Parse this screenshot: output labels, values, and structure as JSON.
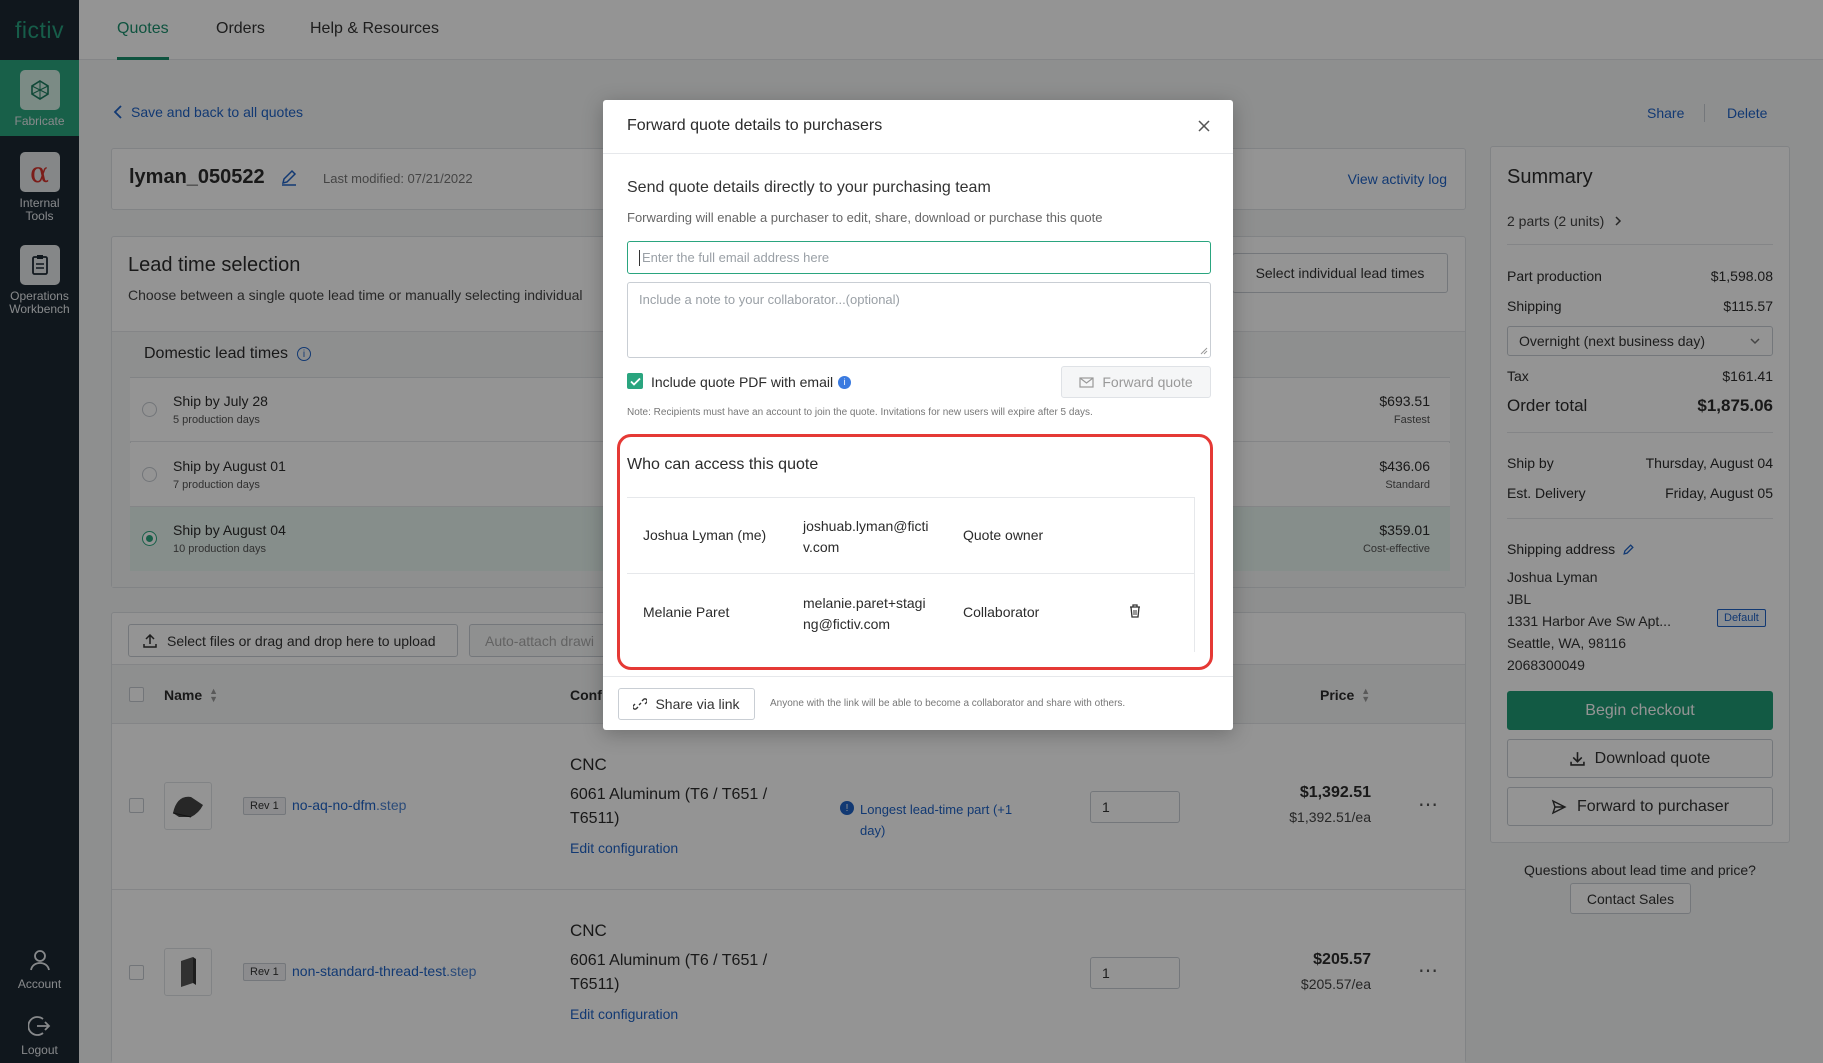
{
  "app": {
    "logo": "fictiv"
  },
  "sidebar": {
    "items": [
      {
        "label": "Fabricate"
      },
      {
        "label": "Internal Tools"
      },
      {
        "label": "Operations Workbench"
      }
    ],
    "bottom": [
      {
        "label": "Account"
      },
      {
        "label": "Logout"
      }
    ]
  },
  "topnav": {
    "tabs": [
      {
        "label": "Quotes"
      },
      {
        "label": "Orders"
      },
      {
        "label": "Help & Resources"
      }
    ]
  },
  "page": {
    "back_link": "Save and back to all quotes",
    "share": "Share",
    "delete": "Delete",
    "quote_name": "lyman_050522",
    "last_modified": "Last modified: 07/21/2022",
    "activity_log": "View activity log"
  },
  "lead": {
    "title": "Lead time selection",
    "subtitle": "Choose between a single quote lead time or manually selecting individual",
    "select_individual": "Select individual lead times",
    "domestic": "Domestic lead times",
    "options": [
      {
        "title": "Ship by July 28",
        "days": "5 production days",
        "price": "$693.51",
        "tag": "Fastest"
      },
      {
        "title": "Ship by August 01",
        "days": "7 production days",
        "price": "$436.06",
        "tag": "Standard"
      },
      {
        "title": "Ship by August 04",
        "days": "10 production days",
        "price": "$359.01",
        "tag": "Cost-effective"
      }
    ]
  },
  "upload": {
    "select_files": "Select files or drag and drop here to upload",
    "auto_attach": "Auto-attach drawi"
  },
  "table": {
    "headers": {
      "name": "Name",
      "config": "Conf",
      "price": "Price"
    },
    "rows": [
      {
        "rev": "Rev 1",
        "file_name": "no-aq-no-dfm",
        "file_ext": ".step",
        "process": "CNC",
        "material": "6061 Aluminum (T6 / T651 / T6511)",
        "edit": "Edit configuration",
        "notice": "Longest lead-time part (+1 day)",
        "qty": "1",
        "price": "$1,392.51",
        "unit": "$1,392.51/ea"
      },
      {
        "rev": "Rev 1",
        "file_name": "non-standard-thread-test",
        "file_ext": ".step",
        "process": "CNC",
        "material": "6061 Aluminum (T6 / T651 / T6511)",
        "edit": "Edit configuration",
        "notice": "",
        "qty": "1",
        "price": "$205.57",
        "unit": "$205.57/ea"
      }
    ]
  },
  "summary": {
    "title": "Summary",
    "parts": "2 parts (2 units)",
    "part_production_label": "Part production",
    "part_production": "$1,598.08",
    "shipping_label": "Shipping",
    "shipping": "$115.57",
    "shipping_method": "Overnight (next business day)",
    "tax_label": "Tax",
    "tax": "$161.41",
    "order_total_label": "Order total",
    "order_total": "$1,875.06",
    "ship_by_label": "Ship by",
    "ship_by": "Thursday, August 04",
    "delivery_label": "Est. Delivery",
    "delivery": "Friday, August 05",
    "address_label": "Shipping address",
    "address": {
      "name": "Joshua Lyman",
      "company": "JBL",
      "street": "1331 Harbor Ave Sw Apt...",
      "city": "Seattle, WA, 98116",
      "phone": "2068300049",
      "badge": "Default"
    },
    "checkout": "Begin checkout",
    "download": "Download quote",
    "forward": "Forward to purchaser",
    "questions": "Questions about lead time and price?",
    "contact": "Contact Sales"
  },
  "modal": {
    "title": "Forward quote details to purchasers",
    "heading": "Send quote details directly to your purchasing team",
    "description": "Forwarding will enable a purchaser to edit, share, download or purchase this quote",
    "email_placeholder": "Enter the full email address here",
    "note_placeholder": "Include a note to your collaborator...(optional)",
    "include_pdf": "Include quote PDF with email",
    "forward_button": "Forward quote",
    "note": "Note: Recipients must have an account to join the quote. Invitations for new users will expire after 5 days.",
    "access_title": "Who can access this quote",
    "people": [
      {
        "name": "Joshua Lyman (me)",
        "email_l1": "joshuab.lyman@ficti",
        "email_l2": "v.com",
        "role": "Quote owner"
      },
      {
        "name": "Melanie Paret",
        "email_l1": "melanie.paret+stagi",
        "email_l2": "ng@fictiv.com",
        "role": "Collaborator"
      }
    ],
    "share_link": "Share via link",
    "share_note": "Anyone with the link will be able to become a collaborator and share with others."
  },
  "colors": {
    "brand_green": "#1f9c76",
    "sidebar": "#1d2833",
    "link_blue": "#1f63c6",
    "highlight_red": "#e53935"
  }
}
